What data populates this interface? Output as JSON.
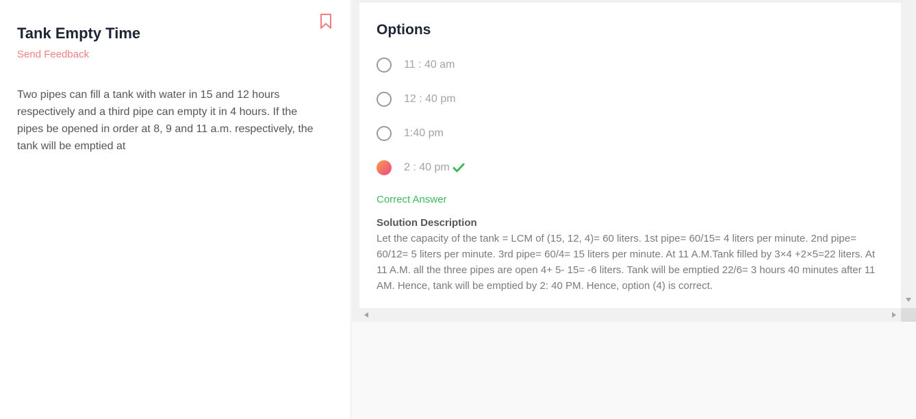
{
  "question_panel": {
    "title": "Tank Empty Time",
    "feedback_link": "Send Feedback",
    "bookmark_icon": "bookmark-icon",
    "question_text": "Two pipes can fill a tank with water in 15 and 12 hours respectively and a third pipe can empty it in 4 hours. If the pipes be opened in order at 8, 9 and 11 a.m. respectively, the tank will be emptied at"
  },
  "options_panel": {
    "title": "Options",
    "options": [
      {
        "label": "11 : 40 am",
        "selected": false
      },
      {
        "label": "12 : 40 pm",
        "selected": false
      },
      {
        "label": "1:40 pm",
        "selected": false
      },
      {
        "label": "2 : 40 pm",
        "selected": true,
        "correct_icon": "check-icon"
      }
    ],
    "correct_label": "Correct Answer",
    "solution_title": "Solution Description",
    "solution_text": "Let the capacity of the tank = LCM of (15, 12, 4)= 60 liters. 1st pipe= 60/15= 4 liters per minute. 2nd pipe= 60/12= 5 liters per minute. 3rd pipe= 60/4= 15 liters per minute. At 11 A.M.Tank filled by 3×4 +2×5=22 liters. At 11 A.M. all the three pipes are open 4+ 5- 15= -6 liters. Tank will be emptied 22/6= 3 hours 40 minutes after 11 AM. Hence, tank will be emptied by 2: 40 PM. Hence, option (4) is correct."
  },
  "colors": {
    "accent": "#f08080",
    "correct": "#3cb85b",
    "title": "#1f2533"
  }
}
